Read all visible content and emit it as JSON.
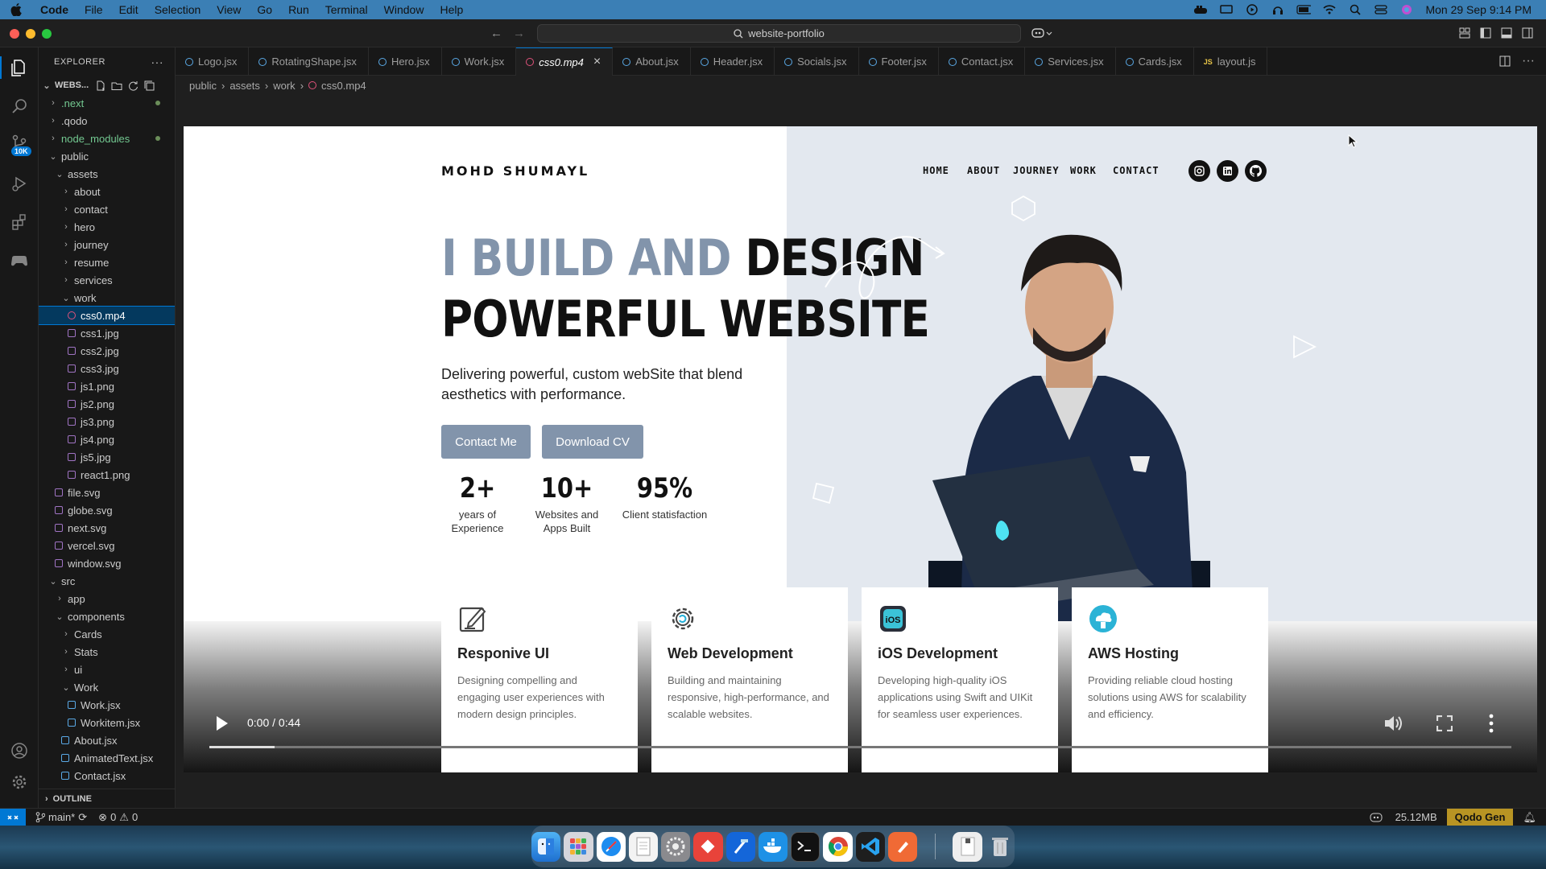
{
  "menubar": {
    "app": "Code",
    "items": [
      "File",
      "Edit",
      "Selection",
      "View",
      "Go",
      "Run",
      "Terminal",
      "Window",
      "Help"
    ],
    "clock": "Mon 29 Sep  9:14 PM"
  },
  "titlebar": {
    "search": "website-portfolio"
  },
  "activity": {
    "scm_badge": "10K"
  },
  "explorer": {
    "header": "EXPLORER",
    "root": "WEBS...",
    "tree": [
      {
        "label": ".next",
        "depth": 1,
        "type": "folder",
        "open": false,
        "color": "#73c991",
        "dot": true
      },
      {
        "label": ".qodo",
        "depth": 1,
        "type": "folder",
        "open": false
      },
      {
        "label": "node_modules",
        "depth": 1,
        "type": "folder",
        "open": false,
        "color": "#73c991",
        "dot": true
      },
      {
        "label": "public",
        "depth": 1,
        "type": "folder",
        "open": true
      },
      {
        "label": "assets",
        "depth": 2,
        "type": "folder",
        "open": true
      },
      {
        "label": "about",
        "depth": 3,
        "type": "folder",
        "open": false
      },
      {
        "label": "contact",
        "depth": 3,
        "type": "folder",
        "open": false
      },
      {
        "label": "hero",
        "depth": 3,
        "type": "folder",
        "open": false
      },
      {
        "label": "journey",
        "depth": 3,
        "type": "folder",
        "open": false
      },
      {
        "label": "resume",
        "depth": 3,
        "type": "folder",
        "open": false
      },
      {
        "label": "services",
        "depth": 3,
        "type": "folder",
        "open": false
      },
      {
        "label": "work",
        "depth": 3,
        "type": "folder",
        "open": true
      },
      {
        "label": "css0.mp4",
        "depth": 4,
        "type": "video",
        "selected": true
      },
      {
        "label": "css1.jpg",
        "depth": 4,
        "type": "image"
      },
      {
        "label": "css2.jpg",
        "depth": 4,
        "type": "image"
      },
      {
        "label": "css3.jpg",
        "depth": 4,
        "type": "image"
      },
      {
        "label": "js1.png",
        "depth": 4,
        "type": "image"
      },
      {
        "label": "js2.png",
        "depth": 4,
        "type": "image"
      },
      {
        "label": "js3.png",
        "depth": 4,
        "type": "image"
      },
      {
        "label": "js4.png",
        "depth": 4,
        "type": "image"
      },
      {
        "label": "js5.jpg",
        "depth": 4,
        "type": "image"
      },
      {
        "label": "react1.png",
        "depth": 4,
        "type": "image"
      },
      {
        "label": "file.svg",
        "depth": 2,
        "type": "svg"
      },
      {
        "label": "globe.svg",
        "depth": 2,
        "type": "svg"
      },
      {
        "label": "next.svg",
        "depth": 2,
        "type": "svg"
      },
      {
        "label": "vercel.svg",
        "depth": 2,
        "type": "svg"
      },
      {
        "label": "window.svg",
        "depth": 2,
        "type": "svg"
      },
      {
        "label": "src",
        "depth": 1,
        "type": "folder",
        "open": true
      },
      {
        "label": "app",
        "depth": 2,
        "type": "folder",
        "open": false
      },
      {
        "label": "components",
        "depth": 2,
        "type": "folder",
        "open": true
      },
      {
        "label": "Cards",
        "depth": 3,
        "type": "folder",
        "open": false
      },
      {
        "label": "Stats",
        "depth": 3,
        "type": "folder",
        "open": false
      },
      {
        "label": "ui",
        "depth": 3,
        "type": "folder",
        "open": false
      },
      {
        "label": "Work",
        "depth": 3,
        "type": "folder",
        "open": true
      },
      {
        "label": "Work.jsx",
        "depth": 4,
        "type": "react"
      },
      {
        "label": "Workitem.jsx",
        "depth": 4,
        "type": "react"
      },
      {
        "label": "About.jsx",
        "depth": 3,
        "type": "react"
      },
      {
        "label": "AnimatedText.jsx",
        "depth": 3,
        "type": "react"
      },
      {
        "label": "Contact.jsx",
        "depth": 3,
        "type": "react"
      }
    ],
    "outline": "OUTLINE"
  },
  "tabs": [
    {
      "label": "Logo.jsx"
    },
    {
      "label": "RotatingShape.jsx"
    },
    {
      "label": "Hero.jsx"
    },
    {
      "label": "Work.jsx"
    },
    {
      "label": "css0.mp4",
      "active": true
    },
    {
      "label": "About.jsx"
    },
    {
      "label": "Header.jsx"
    },
    {
      "label": "Socials.jsx"
    },
    {
      "label": "Footer.jsx"
    },
    {
      "label": "Contact.jsx"
    },
    {
      "label": "Services.jsx"
    },
    {
      "label": "Cards.jsx"
    },
    {
      "label": "layout.js",
      "js": true
    }
  ],
  "breadcrumb": [
    "public",
    "assets",
    "work",
    "css0.mp4"
  ],
  "video": {
    "logo": "MOHD SHUMAYL",
    "nav": [
      "HOME",
      "ABOUT",
      "JOURNEY",
      "WORK",
      "CONTACT"
    ],
    "headline_grey": "I BUILD AND ",
    "headline_dark1": "DESIGN",
    "headline_dark2": "POWERFUL WEBSITE",
    "subtitle": "Delivering powerful, custom webSite that blend aesthetics with performance.",
    "btn_contact": "Contact Me",
    "btn_cv": "Download CV",
    "stats": [
      {
        "value": "2+",
        "label": "years of Experience"
      },
      {
        "value": "10+",
        "label": "Websites and Apps Built"
      },
      {
        "value": "95%",
        "label": "Client statisfaction"
      }
    ],
    "cards": [
      {
        "title": "Responive UI",
        "desc": "Designing compelling and engaging user experiences with modern design principles.",
        "icon": "edit-icon"
      },
      {
        "title": "Web Development",
        "desc": "Building and maintaining responsive, high-performance, and scalable websites.",
        "icon": "gear-icon"
      },
      {
        "title": "iOS Development",
        "desc": "Developing high-quality iOS applications using Swift and UIKit for seamless user experiences.",
        "icon": "ios-icon"
      },
      {
        "title": "AWS Hosting",
        "desc": "Providing reliable cloud hosting solutions using AWS for scalability and efficiency.",
        "icon": "cloud-icon"
      }
    ],
    "time": "0:00 / 0:44",
    "progress_fraction": 0.05
  },
  "statusbar": {
    "branch": "main*",
    "errors": "0",
    "warnings": "0",
    "memory": "25.12MB",
    "qodo": "Qodo Gen"
  },
  "colors": {
    "accent": "#0078d4",
    "brand_grey": "#8294ab",
    "menubar": "#3b7fb5"
  }
}
